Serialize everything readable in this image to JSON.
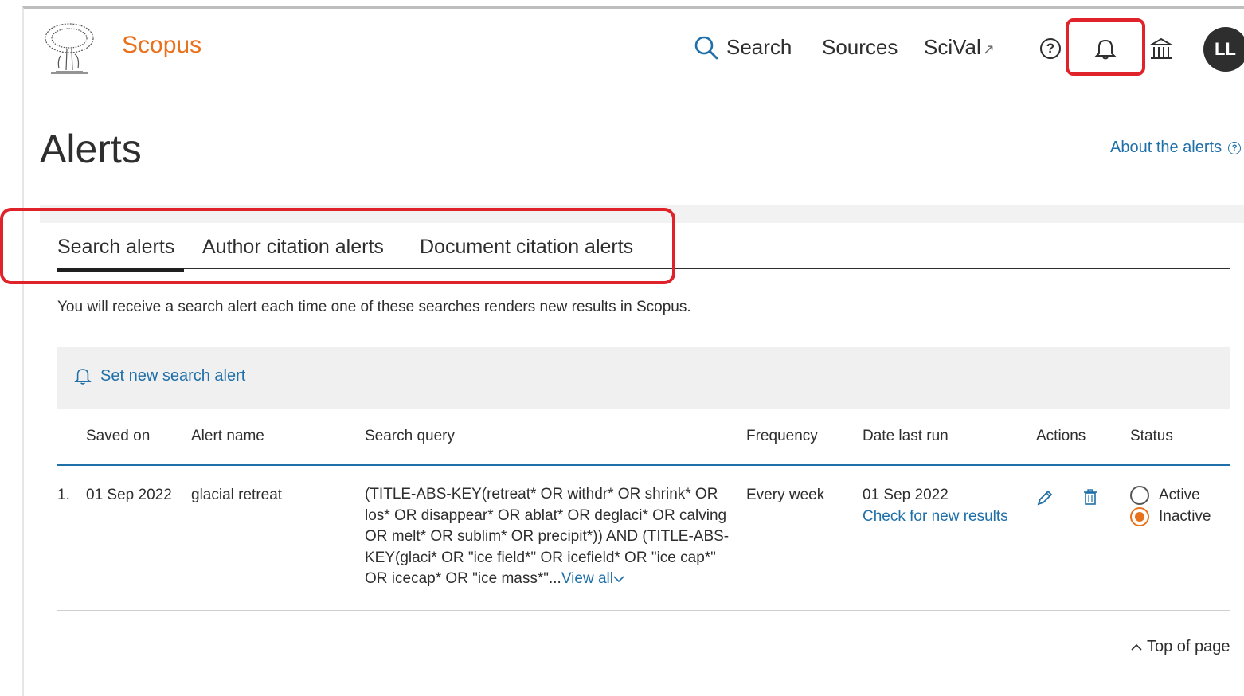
{
  "header": {
    "brand": "Scopus",
    "nav": {
      "search": "Search",
      "sources": "Sources",
      "scival": "SciVal",
      "scival_ext": "↗"
    },
    "help_glyph": "?",
    "avatar_initials": "LL",
    "icons": [
      "elsevier-logo",
      "search-icon",
      "external-link-icon",
      "help-icon",
      "bell-icon",
      "institution-icon"
    ]
  },
  "page": {
    "title": "Alerts",
    "about_link": "About the alerts",
    "about_glyph": "?"
  },
  "tabs": [
    {
      "label": "Search alerts",
      "active": true
    },
    {
      "label": "Author citation alerts",
      "active": false
    },
    {
      "label": "Document citation alerts",
      "active": false
    }
  ],
  "description": "You will receive a search alert each time one of these searches renders new results in Scopus.",
  "new_alert_button": "Set new search alert",
  "table": {
    "headers": {
      "saved_on": "Saved on",
      "alert_name": "Alert name",
      "search_query": "Search query",
      "frequency": "Frequency",
      "date_last_run": "Date last run",
      "actions": "Actions",
      "status": "Status"
    },
    "rows": [
      {
        "index": "1.",
        "saved_on": "01 Sep 2022",
        "alert_name": "glacial retreat",
        "search_query": "(TITLE-ABS-KEY(retreat* OR withdr* OR shrink* OR los* OR disappear* OR ablat* OR deglaci* OR calving OR melt* OR sublim* OR precipit*)) AND (TITLE-ABS-KEY(glaci* OR \"ice field*\" OR icefield* OR \"ice cap*\" OR icecap* OR \"ice mass*\"...",
        "view_all": "View all",
        "frequency": "Every week",
        "date_last_run": "01 Sep 2022",
        "check_link": "Check for new results",
        "status_options": [
          "Active",
          "Inactive"
        ],
        "status_selected": "Inactive"
      }
    ]
  },
  "footer": {
    "top_of_page": "Top of page"
  },
  "colors": {
    "brand": "#e9711c",
    "link": "#1f6fa8",
    "highlight": "#e0232a"
  }
}
